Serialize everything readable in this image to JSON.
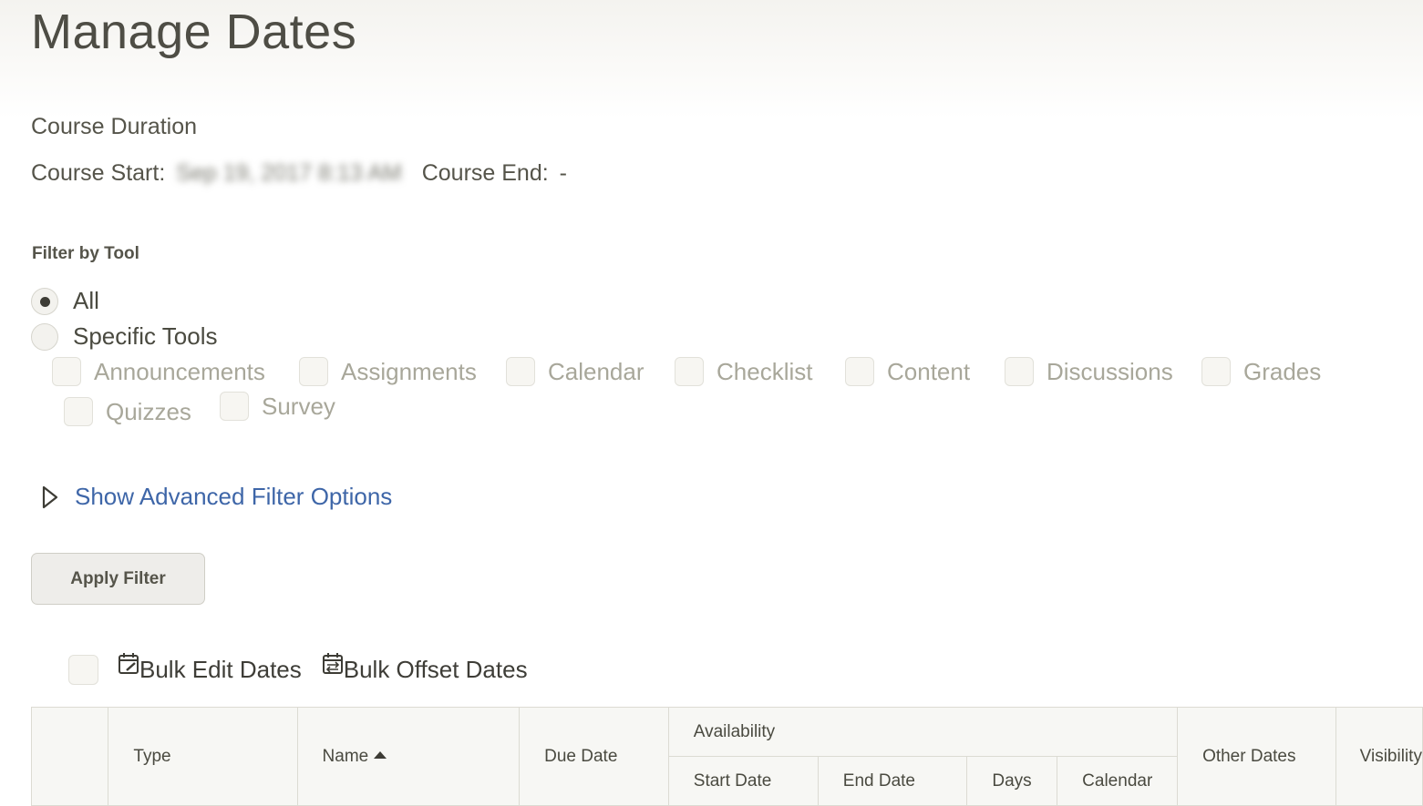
{
  "page": {
    "title": "Manage Dates"
  },
  "course": {
    "duration_heading": "Course Duration",
    "start_label": "Course Start:",
    "start_value": "Sep 19, 2017 8:13 AM",
    "end_label": "Course End:",
    "end_value": "-"
  },
  "filter": {
    "heading": "Filter by Tool",
    "options": [
      {
        "label": "All",
        "selected": true
      },
      {
        "label": "Specific Tools",
        "selected": false
      }
    ],
    "tools": [
      "Announcements",
      "Assignments",
      "Calendar",
      "Checklist",
      "Content",
      "Discussions",
      "Grades",
      "Quizzes",
      "Survey"
    ],
    "advanced_link": "Show Advanced Filter Options",
    "apply_button": "Apply Filter"
  },
  "bulk": {
    "edit_label": "Bulk Edit Dates",
    "offset_label": "Bulk Offset Dates",
    "icons": [
      "calendar-edit-icon",
      "calendar-offset-icon"
    ]
  },
  "table": {
    "headers": {
      "type": "Type",
      "name": "Name",
      "due_date": "Due Date",
      "availability": "Availability",
      "start_date": "Start Date",
      "end_date": "End Date",
      "days": "Days",
      "calendar": "Calendar",
      "other_dates": "Other Dates",
      "visibility": "Visibility"
    },
    "sort": {
      "column": "Name",
      "direction": "ascending"
    }
  },
  "colors": {
    "link": "#3e66a8",
    "text": "#4a4a40",
    "disabled_text": "#a8a79a",
    "header_bg": "#f7f7f4"
  }
}
